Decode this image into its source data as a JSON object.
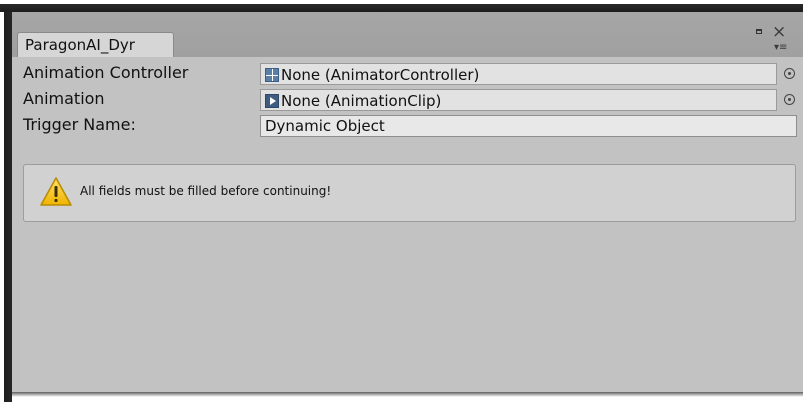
{
  "window": {
    "tab_title": "ParagonAI_Dyr",
    "maximize_label": "",
    "close_label": "×",
    "menu_label": "▾≡"
  },
  "fields": {
    "animation_controller": {
      "label": "Animation Controller",
      "value": "None (AnimatorController)",
      "icon": "animator-controller-icon"
    },
    "animation": {
      "label": "Animation",
      "value": "None (AnimationClip)",
      "icon": "animation-clip-icon"
    },
    "trigger_name": {
      "label": "Trigger Name:",
      "value": "Dynamic Object"
    }
  },
  "help": {
    "icon": "warning-icon",
    "message": "All fields must be filled before continuing!"
  },
  "colors": {
    "panel_bg": "#c2c2c2",
    "tabbar_bg": "#a3a3a3",
    "warning_yellow": "#f5c400"
  }
}
